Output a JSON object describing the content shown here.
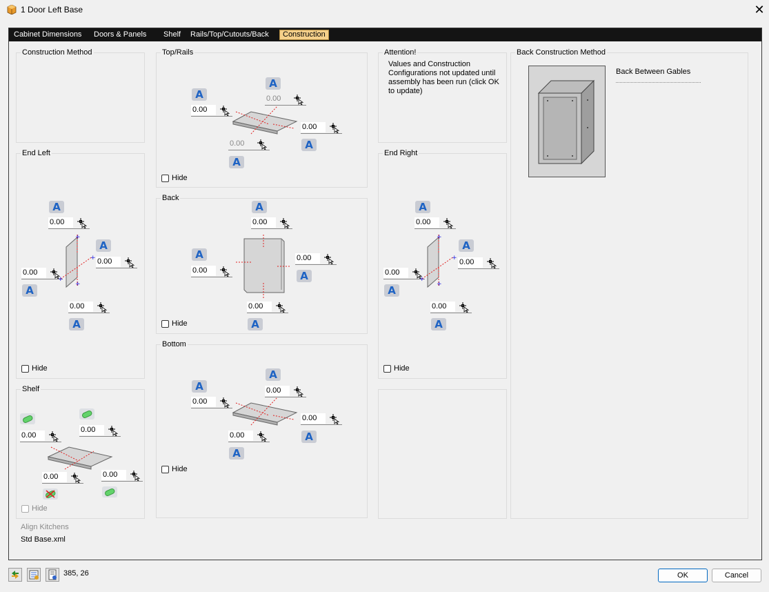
{
  "window": {
    "title": "1 Door Left Base",
    "close_glyph": "✕"
  },
  "tabs": [
    "Cabinet Dimensions",
    "Doors & Panels",
    "Shelf",
    "Rails/Top/Cutouts/Back",
    "Construction"
  ],
  "active_tab": "Construction",
  "groups": {
    "construction_method": "Construction Method",
    "end_left": "End Left",
    "shelf": "Shelf",
    "top_rails": "Top/Rails",
    "back": "Back",
    "bottom": "Bottom",
    "end_right": "End Right",
    "back_construction_method": "Back Construction Method"
  },
  "attention": {
    "title": "Attention!",
    "message": "Values and Construction Configurations not updated until assembly has been run (click OK to update)"
  },
  "field_value": "0.00",
  "hide_label": "Hide",
  "back_method_value": "Back Between Gables",
  "align": {
    "label": "Align Kitchens",
    "value": "Std Base.xml"
  },
  "status_coords": "385, 26",
  "buttons": {
    "ok": "OK",
    "cancel": "Cancel"
  },
  "icons": {
    "app": "cabinet-cube-icon",
    "auto": "letter-a-icon",
    "picker": "crosshair-picker-icon",
    "pill": "green-pill-icon"
  },
  "colors": {
    "tab_bar": "#141414",
    "active_tab": "#f5d08a",
    "auto_icon": "#1e63c4",
    "pill_green": "#63d36b",
    "arrow_red": "#e02020",
    "arrow_blue": "#2020e0"
  }
}
